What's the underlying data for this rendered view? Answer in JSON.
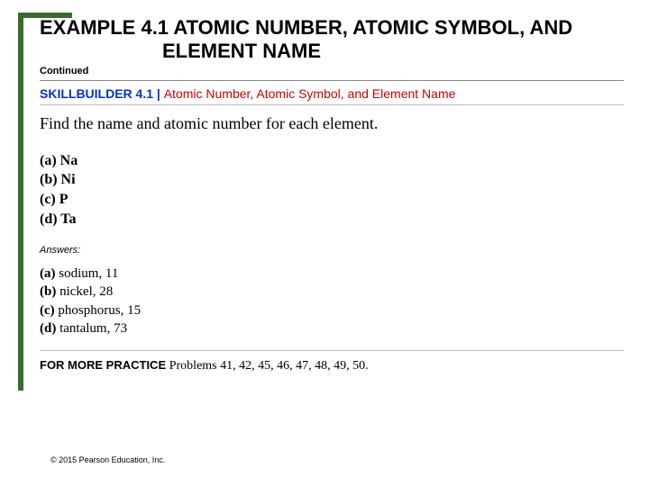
{
  "title_line1": "EXAMPLE 4.1 ATOMIC NUMBER, ATOMIC SYMBOL, AND",
  "title_line2": "ELEMENT NAME",
  "continued": "Continued",
  "skillbuilder": {
    "bold": "SKILLBUILDER 4.1 | ",
    "rest": "Atomic Number, Atomic Symbol, and Element Name"
  },
  "instruction": "Find the name and atomic number for each element.",
  "items": [
    "(a) Na",
    "(b) Ni",
    "(c) P",
    "(d) Ta"
  ],
  "answers_label": "Answers:",
  "answers": [
    {
      "lbl": "(a)",
      "val": " sodium, 11"
    },
    {
      "lbl": "(b)",
      "val": " nickel, 28"
    },
    {
      "lbl": "(c)",
      "val": " phosphorus, 15"
    },
    {
      "lbl": "(d)",
      "val": " tantalum, 73"
    }
  ],
  "more_practice": {
    "bold": "FOR MORE PRACTICE ",
    "rest": "Problems 41, 42, 45, 46, 47, 48, 49, 50."
  },
  "copyright": "© 2015 Pearson Education, Inc."
}
